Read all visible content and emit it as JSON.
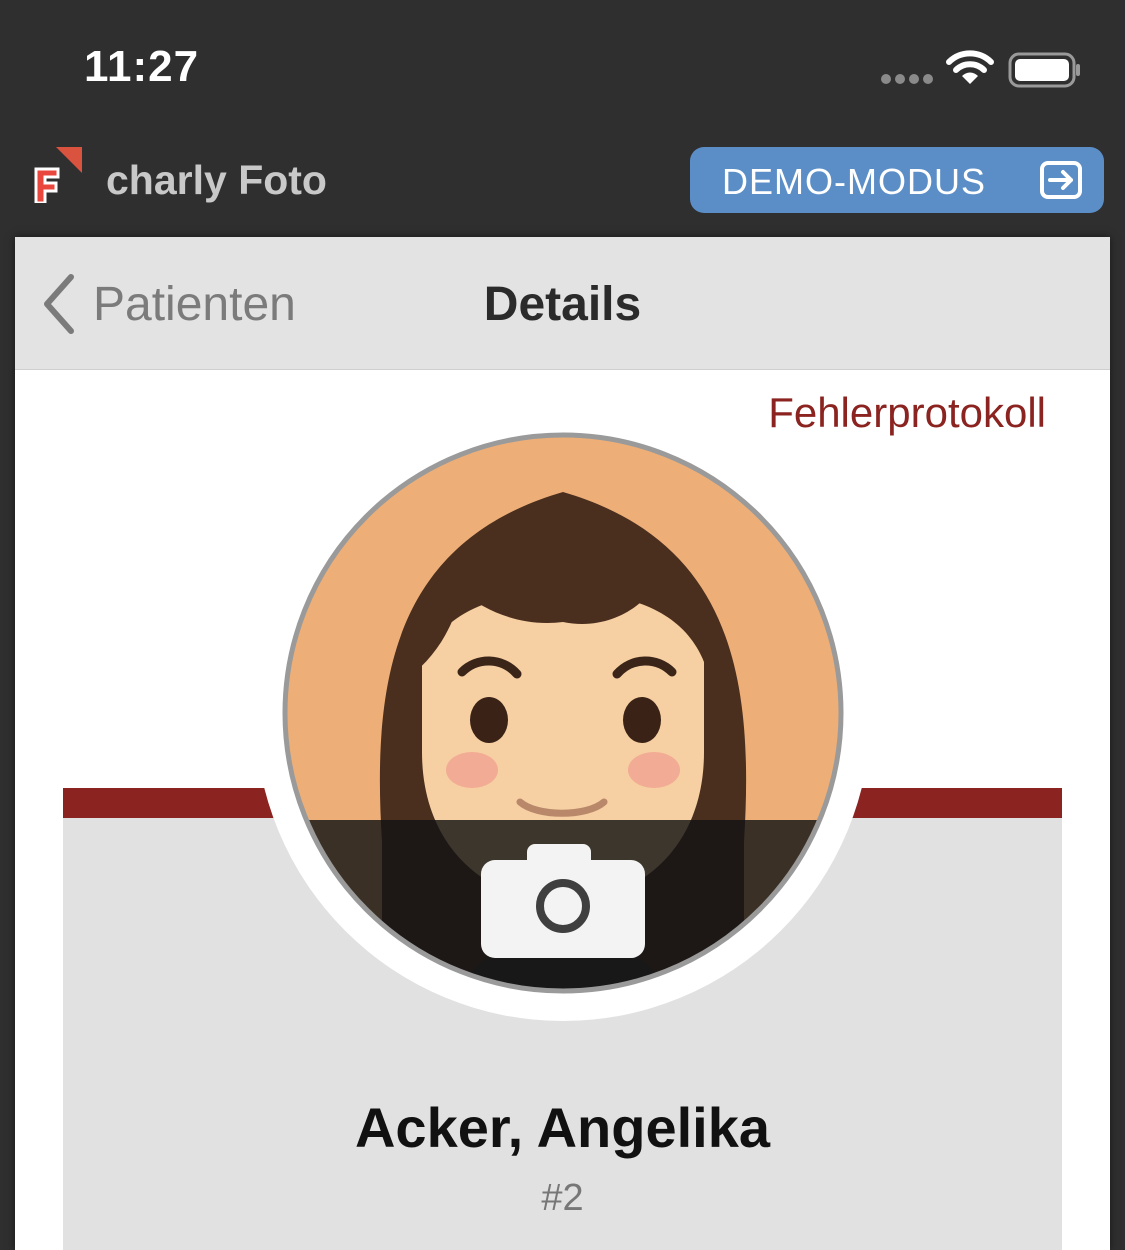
{
  "status_bar": {
    "time": "11:27",
    "icons": [
      "cellular-signal-icon",
      "wifi-icon",
      "battery-icon"
    ]
  },
  "app_header": {
    "title": "charly Foto",
    "logo": "charly-foto-logo",
    "demo_button_label": "DEMO-MODUS",
    "demo_button_icon": "exit-icon",
    "demo_button_color": "#5b8ec7"
  },
  "navbar": {
    "back_label": "Patienten",
    "back_icon": "chevron-left-icon",
    "title": "Details"
  },
  "content": {
    "error_log_link": "Fehlerprotokoll",
    "avatar_icon": "female-avatar",
    "camera_icon": "camera-icon",
    "patient_name": "Acker, Angelika",
    "patient_id": "#2",
    "accent_color": "#8b2420"
  }
}
